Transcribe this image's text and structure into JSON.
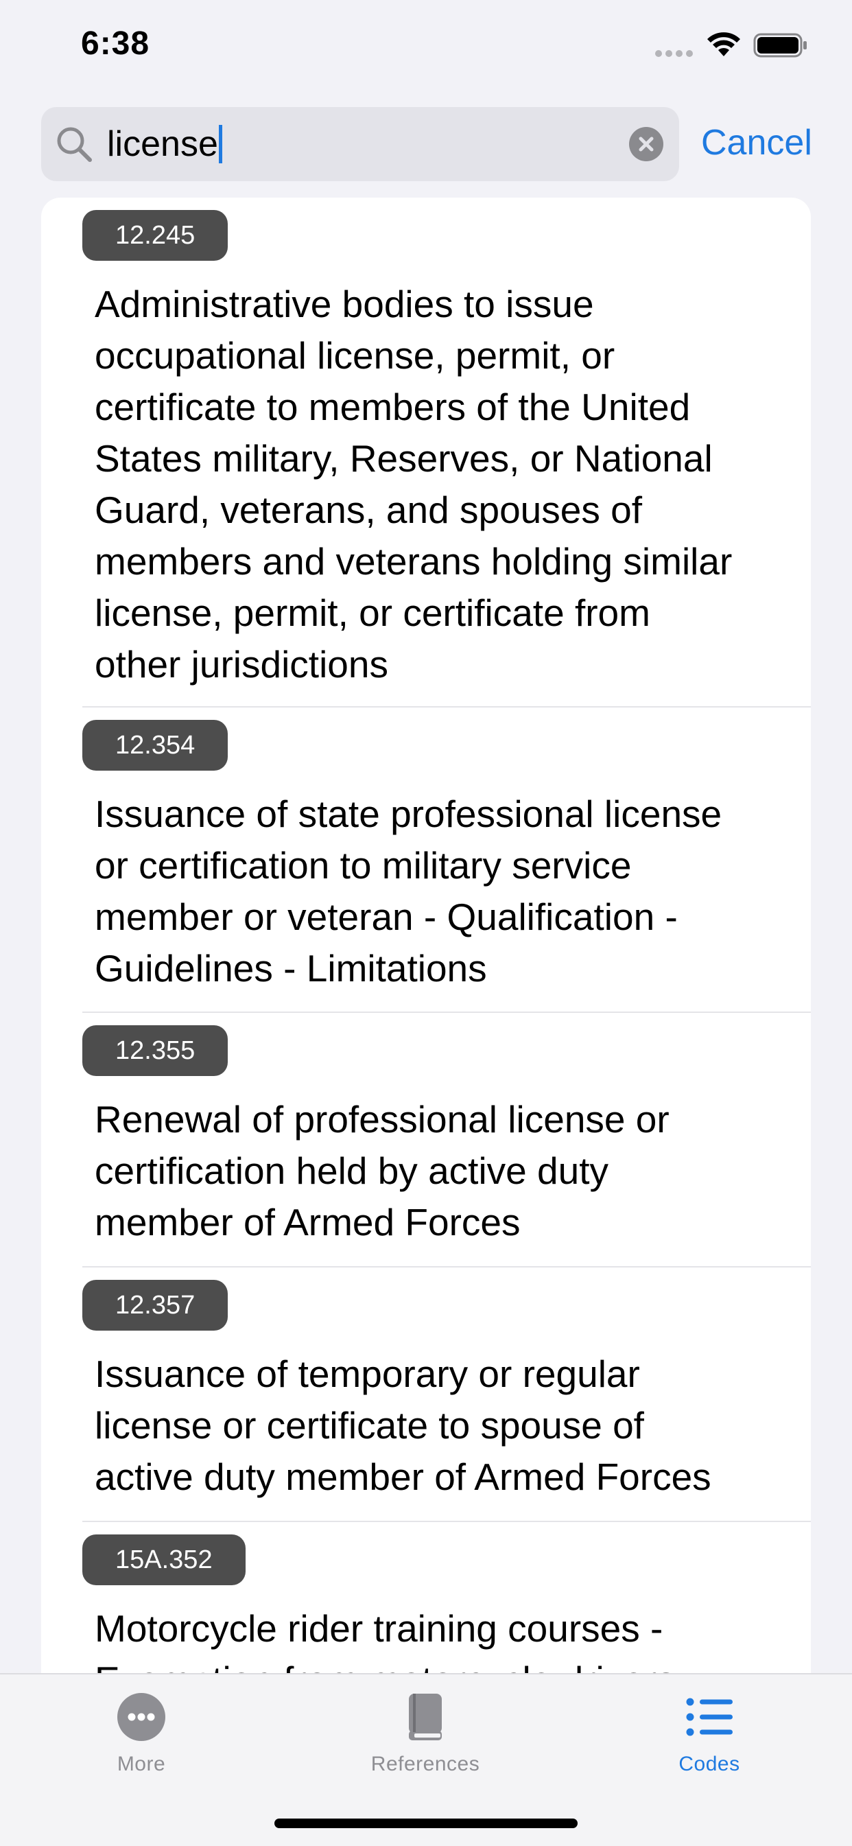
{
  "status_bar": {
    "time": "6:38"
  },
  "search": {
    "query": "license",
    "cancel_label": "Cancel"
  },
  "results": [
    {
      "code": "12.245",
      "lines": [
        "Administrative bodies to issue",
        "occupational license, permit, or",
        "certificate to members of the United",
        "States military, Reserves, or National",
        "Guard, veterans, and spouses of",
        "members and veterans holding similar",
        "license, permit, or certificate from",
        "other jurisdictions"
      ]
    },
    {
      "code": "12.354",
      "lines": [
        "Issuance of state professional license",
        "or certification to military service",
        "member or veteran - Qualification -",
        "Guidelines - Limitations"
      ]
    },
    {
      "code": "12.355",
      "lines": [
        "Renewal of professional license or",
        "certification held by active duty",
        "member of Armed Forces"
      ]
    },
    {
      "code": "12.357",
      "lines": [
        "Issuance of temporary or regular",
        "license or certificate to spouse of",
        "active duty member of Armed Forces"
      ]
    },
    {
      "code": "15A.352",
      "lines": [
        "Motorcycle rider training courses -",
        "Exemption from motorcycle drivers"
      ]
    }
  ],
  "tab_bar": {
    "tabs": [
      {
        "label": "More",
        "icon": "more-icon",
        "active": false
      },
      {
        "label": "References",
        "icon": "book-icon",
        "active": false
      },
      {
        "label": "Codes",
        "icon": "list-icon",
        "active": true
      }
    ]
  },
  "colors": {
    "accent": "#1f7ae0",
    "inactive_tab": "#8e8e93",
    "badge_background": "#4d4d4d",
    "page_background": "#f2f2f7"
  }
}
